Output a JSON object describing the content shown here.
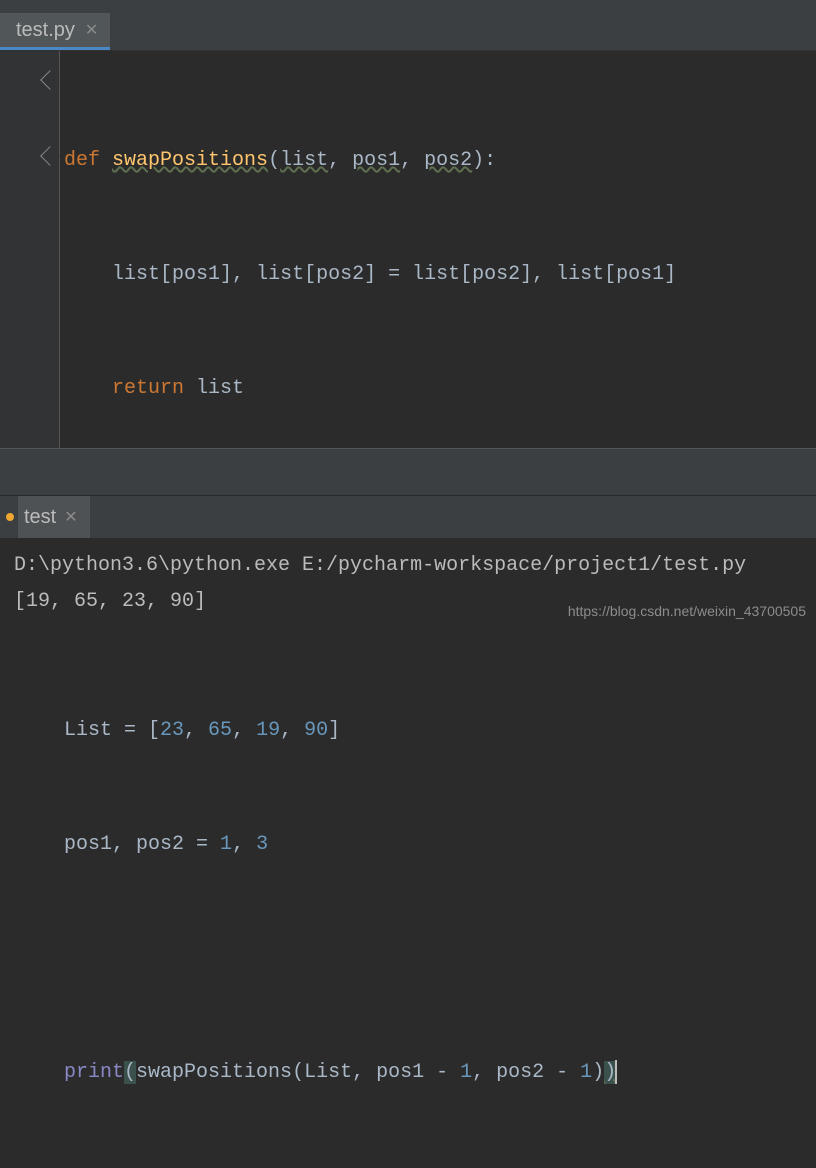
{
  "tab": {
    "label": "test.py"
  },
  "code": {
    "def": "def",
    "fnName": "swapPositions",
    "p1": "list",
    "p2": "pos1",
    "p3": "pos2",
    "body1_a": "list[pos1]",
    "body1_b": "list[pos2] = list[pos2]",
    "body1_c": "list[pos1]",
    "return": "return",
    "ret_val": "list",
    "listAssignLhs": "List = [",
    "n1": "23",
    "n2": "65",
    "n3": "19",
    "n4": "90",
    "posAssignLhs": "pos1",
    "posAssignMid": "pos2 = ",
    "posV1": "1",
    "posV2": "3",
    "print": "print",
    "callFn": "swapPositions",
    "callArg1": "List",
    "callArg2": "pos1 - ",
    "callN1": "1",
    "callArg3": "pos2 - ",
    "callN2": "1"
  },
  "run": {
    "tabLabel": "test",
    "cmd": "D:\\python3.6\\python.exe E:/pycharm-workspace/project1/test.py",
    "output": "[19, 65, 23, 90]"
  },
  "watermark": "https://blog.csdn.net/weixin_43700505"
}
